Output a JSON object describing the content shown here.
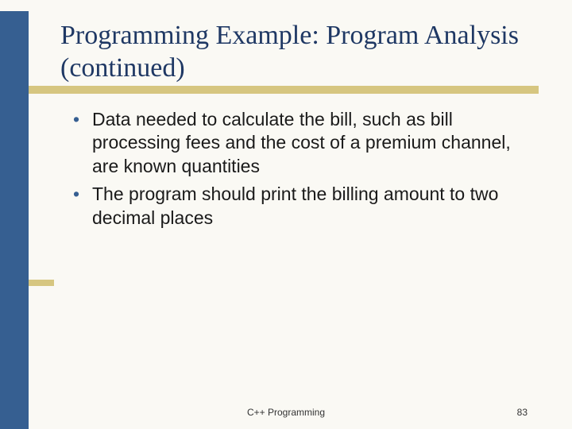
{
  "slide": {
    "title": "Programming Example: Program Analysis (continued)",
    "bullets": [
      "Data needed to calculate the bill, such as bill processing fees and the cost of a premium channel, are known quantities",
      "The program should print the billing amount to two decimal places"
    ],
    "footer": "C++ Programming",
    "page": "83"
  }
}
